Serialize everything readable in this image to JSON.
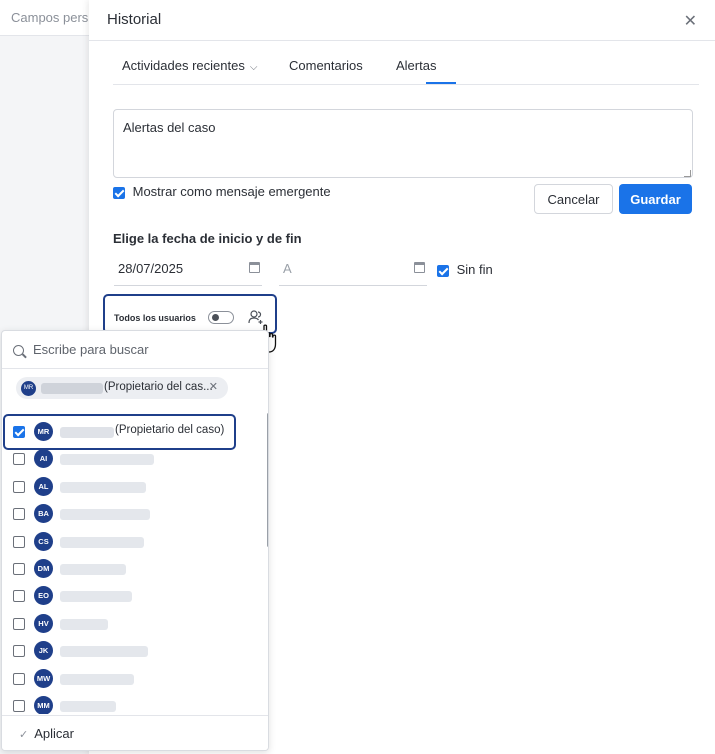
{
  "background": {
    "tab_label": "Campos pers"
  },
  "modal": {
    "title": "Historial",
    "tabs": [
      {
        "label": "Actividades recientes"
      },
      {
        "label": "Comentarios"
      },
      {
        "label": "Alertas"
      }
    ],
    "active_tab": "Alertas",
    "alert_text": "Alertas del caso",
    "popup_label": "Mostrar como mensaje emergente",
    "cancel_label": "Cancelar",
    "save_label": "Guardar",
    "date_section_label": "Elige la fecha de inicio y de fin",
    "start_date": "28/07/2025",
    "end_placeholder": "A",
    "no_end_label": "Sin fin",
    "all_users_label": "Todos los usuarios"
  },
  "dropdown": {
    "search_placeholder": "Escribe para buscar",
    "chip": {
      "initials": "MR",
      "text": "(Propietario del cas..."
    },
    "users": [
      {
        "initials": "MR",
        "suffix": "(Propietario del caso)",
        "checked": true
      },
      {
        "initials": "AI",
        "suffix": "",
        "checked": false
      },
      {
        "initials": "AL",
        "suffix": "",
        "checked": false
      },
      {
        "initials": "BA",
        "suffix": "",
        "checked": false
      },
      {
        "initials": "CS",
        "suffix": "",
        "checked": false
      },
      {
        "initials": "DM",
        "suffix": "",
        "checked": false
      },
      {
        "initials": "EO",
        "suffix": "",
        "checked": false
      },
      {
        "initials": "HV",
        "suffix": "",
        "checked": false
      },
      {
        "initials": "JK",
        "suffix": "",
        "checked": false
      },
      {
        "initials": "MW",
        "suffix": "",
        "checked": false
      },
      {
        "initials": "MM",
        "suffix": "",
        "checked": false
      }
    ],
    "apply_label": "Aplicar"
  },
  "colors": {
    "accent": "#1a73e8",
    "avatar": "#1f3f8a",
    "highlight": "#1f3f8a"
  }
}
